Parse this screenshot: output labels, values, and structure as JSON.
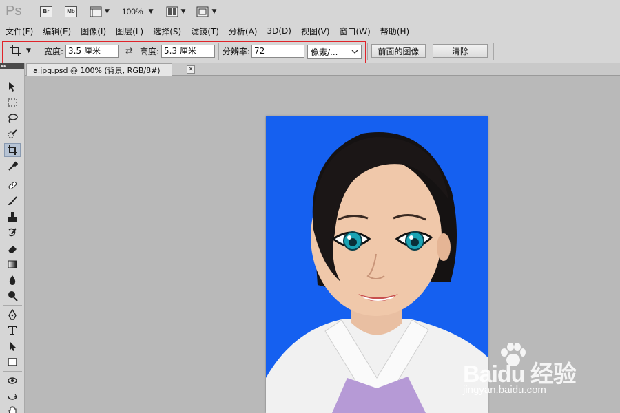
{
  "app": {
    "logo": "Ps",
    "zoom": "100%"
  },
  "menu": [
    "文件(F)",
    "编辑(E)",
    "图像(I)",
    "图层(L)",
    "选择(S)",
    "滤镜(T)",
    "分析(A)",
    "3D(D)",
    "视图(V)",
    "窗口(W)",
    "帮助(H)"
  ],
  "options": {
    "width_label": "宽度:",
    "width_value": "3.5 厘米",
    "height_label": "高度:",
    "height_value": "5.3 厘米",
    "resolution_label": "分辨率:",
    "resolution_value": "72",
    "unit_selected": "像素/...",
    "front_image_button": "前面的图像",
    "clear_button": "清除"
  },
  "document": {
    "tab_title": "a.jpg.psd @ 100% (背景, RGB/8#)"
  },
  "photo": {
    "background_color": "#1560f0"
  },
  "watermark": {
    "brand": "Baidu 经验",
    "url": "jingyan.baidu.com"
  },
  "icons": [
    "bridge-icon",
    "mini-bridge-icon",
    "view-extras-icon",
    "arrange-documents-icon",
    "screen-mode-icon",
    "crop-tool-icon",
    "swap-icon"
  ]
}
